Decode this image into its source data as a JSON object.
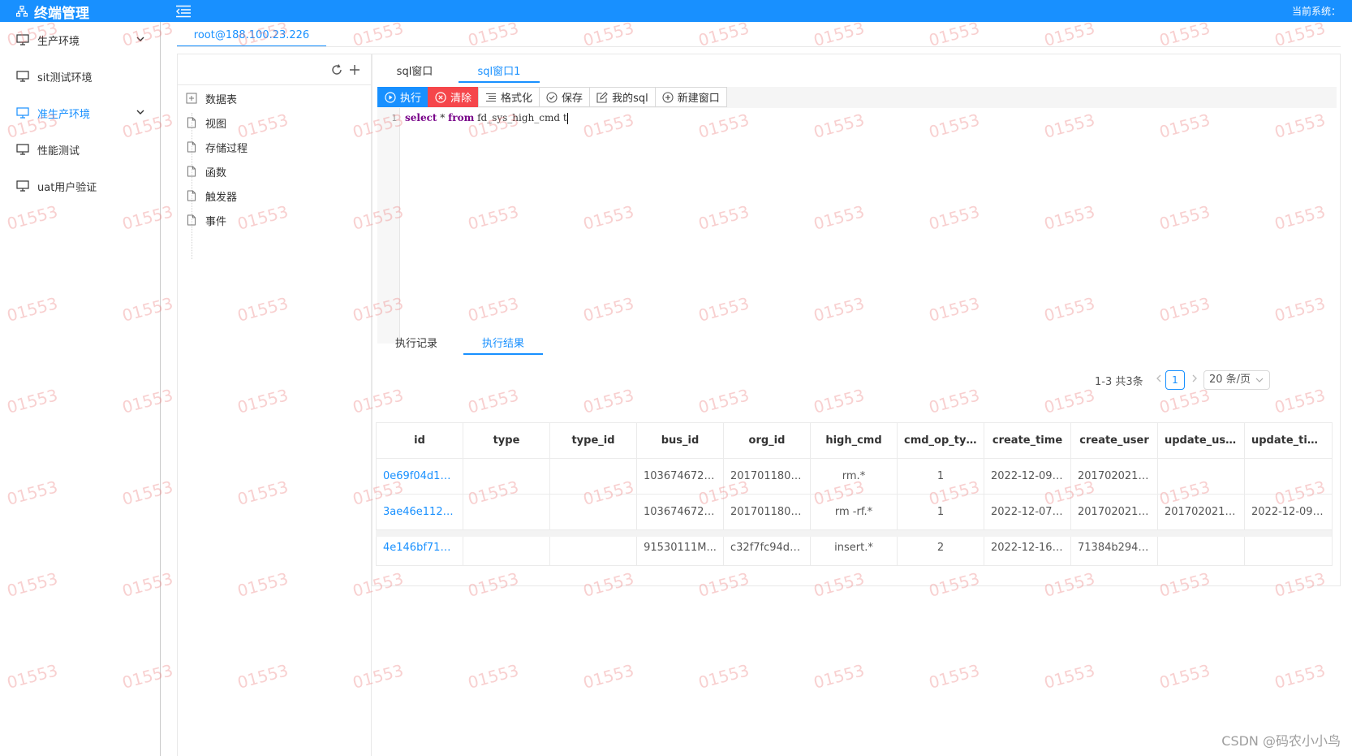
{
  "header": {
    "brand_title": "终端管理",
    "current_system_label": "当前系统："
  },
  "sidebar": {
    "items": [
      {
        "label": "生产环境",
        "expandable": true,
        "active": false
      },
      {
        "label": "sit测试环境",
        "expandable": false,
        "active": false
      },
      {
        "label": "准生产环境",
        "expandable": true,
        "active": true
      },
      {
        "label": "性能测试",
        "expandable": false,
        "active": false
      },
      {
        "label": "uat用户验证",
        "expandable": false,
        "active": false
      }
    ]
  },
  "connection_tab": {
    "label": "root@188.100.23.226"
  },
  "object_tree": {
    "items": [
      {
        "label": "数据表",
        "icon": "table-icon"
      },
      {
        "label": "视图",
        "icon": "file-icon"
      },
      {
        "label": "存储过程",
        "icon": "file-icon"
      },
      {
        "label": "函数",
        "icon": "file-icon"
      },
      {
        "label": "触发器",
        "icon": "file-icon"
      },
      {
        "label": "事件",
        "icon": "file-icon"
      }
    ]
  },
  "sql_tabs": [
    {
      "label": "sql窗口",
      "active": false
    },
    {
      "label": "sql窗口1",
      "active": true
    }
  ],
  "toolbar": {
    "execute_label": "执行",
    "clear_label": "清除",
    "format_label": "格式化",
    "save_label": "保存",
    "my_sql_label": "我的sql",
    "new_window_label": "新建窗口"
  },
  "editor": {
    "line_number": "1",
    "kw_select": "select",
    "star": " * ",
    "kw_from": "from",
    "rest": " fd_sys_high_cmd t"
  },
  "result_tabs": [
    {
      "label": "执行记录",
      "active": false
    },
    {
      "label": "执行结果",
      "active": true
    }
  ],
  "pagination": {
    "total_text": "1-3 共3条",
    "current_page": "1",
    "page_size": "20 条/页"
  },
  "table": {
    "columns": [
      "id",
      "type",
      "type_id",
      "bus_id",
      "org_id",
      "high_cmd",
      "cmd_op_type",
      "create_time",
      "create_user",
      "update_user",
      "update_time"
    ],
    "rows": [
      [
        "0e69f04d14...",
        "",
        "",
        "1036746720...",
        "2017011806...",
        "rm.*",
        "1",
        "2022-12-09 ...",
        "2017020210...",
        "",
        ""
      ],
      [
        "3ae46e1120...",
        "",
        "",
        "1036746720...",
        "2017011806...",
        "rm -rf.*",
        "1",
        "2022-12-07 ...",
        "2017020210...",
        "2017020210...",
        "2022-12-09 ..."
      ],
      [
        "4e146bf717...",
        "",
        "",
        "91530111M...",
        "c32f7fc94db...",
        "insert.*",
        "2",
        "2022-12-16 ...",
        "71384b2942...",
        "",
        ""
      ]
    ]
  },
  "watermark": {
    "text": "01553",
    "csdn_text": "CSDN @码农小小鸟"
  },
  "colors": {
    "primary": "#1890ff",
    "danger": "#f5464b",
    "watermark": "#eb7878"
  }
}
